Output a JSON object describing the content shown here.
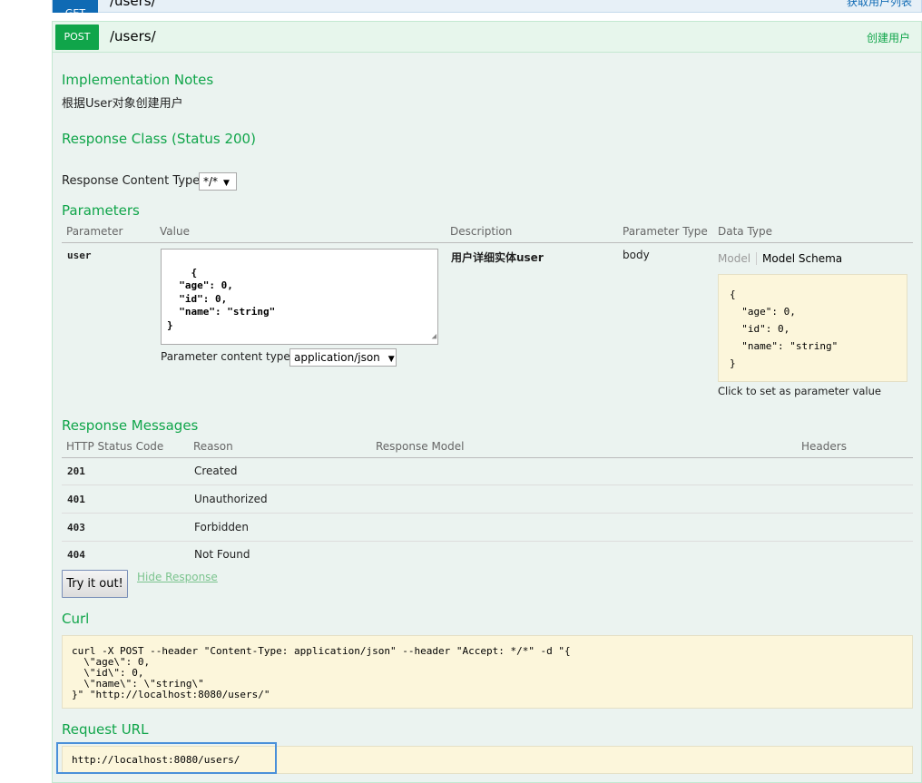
{
  "get_op": {
    "method": "GET",
    "path": "/users/",
    "summary": "获取用户列表"
  },
  "post_op": {
    "method": "POST",
    "path": "/users/",
    "summary": "创建用户"
  },
  "implementation_notes": {
    "heading": "Implementation Notes",
    "text": "根据User对象创建用户"
  },
  "response_class": {
    "heading": "Response Class (Status 200)"
  },
  "response_content_type": {
    "label": "Response Content Type",
    "value": "*/*"
  },
  "parameters": {
    "heading": "Parameters",
    "columns": [
      "Parameter",
      "Value",
      "Description",
      "Parameter Type",
      "Data Type"
    ],
    "row": {
      "name": "user",
      "value": "{\n  \"age\": 0,\n  \"id\": 0,\n  \"name\": \"string\"\n}",
      "description": "用户详细实体user",
      "param_type": "body",
      "content_type_label": "Parameter content type:",
      "content_type_value": "application/json"
    },
    "model_tab": "Model",
    "model_schema_tab": "Model Schema",
    "schema": "{\n  \"age\": 0,\n  \"id\": 0,\n  \"name\": \"string\"\n}",
    "click_hint": "Click to set as parameter value"
  },
  "response_messages": {
    "heading": "Response Messages",
    "columns": [
      "HTTP Status Code",
      "Reason",
      "Response Model",
      "Headers"
    ],
    "rows": [
      {
        "code": "201",
        "reason": "Created"
      },
      {
        "code": "401",
        "reason": "Unauthorized"
      },
      {
        "code": "403",
        "reason": "Forbidden"
      },
      {
        "code": "404",
        "reason": "Not Found"
      }
    ]
  },
  "actions": {
    "try_label": "Try it out!",
    "hide_label": "Hide Response"
  },
  "curl": {
    "heading": "Curl",
    "text": "curl -X POST --header \"Content-Type: application/json\" --header \"Accept: */*\" -d \"{\n  \\\"age\\\": 0,\n  \\\"id\\\": 0,\n  \\\"name\\\": \\\"string\\\"\n}\" \"http://localhost:8080/users/\""
  },
  "request_url": {
    "heading": "Request URL",
    "url": "http://localhost:8080/users/"
  },
  "colors": {
    "post_green": "#10a54a",
    "get_blue": "#0f6ab4",
    "code_bg": "#fcf6db"
  }
}
